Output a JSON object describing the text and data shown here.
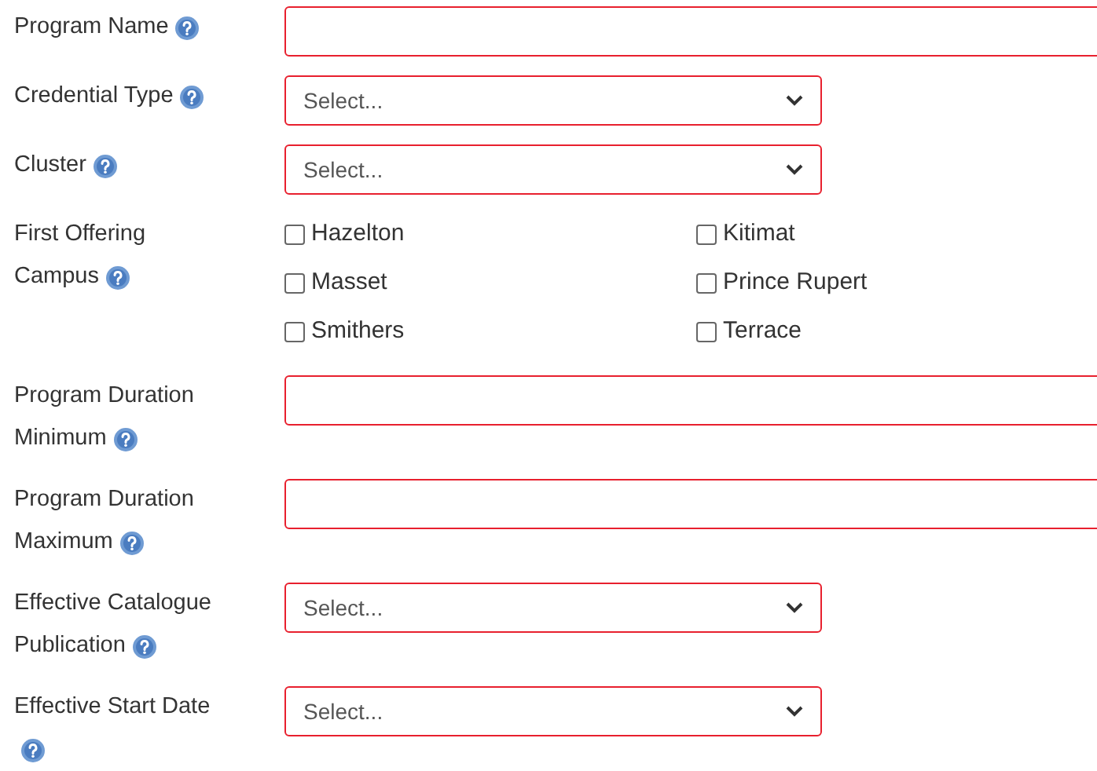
{
  "fields": [
    {
      "kind": "text",
      "label_lines": [
        "Program Name"
      ]
    },
    {
      "kind": "select",
      "label_lines": [
        "Credential Type"
      ],
      "placeholder": "Select..."
    },
    {
      "kind": "select",
      "label_lines": [
        "Cluster"
      ],
      "placeholder": "Select..."
    },
    {
      "kind": "checkboxes",
      "label_lines": [
        "First Offering",
        "Campus"
      ],
      "options": [
        {
          "label": "Hazelton",
          "checked": false
        },
        {
          "label": "Kitimat",
          "checked": false
        },
        {
          "label": "Masset",
          "checked": false
        },
        {
          "label": "Prince Rupert",
          "checked": false
        },
        {
          "label": "Smithers",
          "checked": false
        },
        {
          "label": "Terrace",
          "checked": false
        }
      ]
    },
    {
      "kind": "text",
      "label_lines": [
        "Program Duration",
        "Minimum"
      ]
    },
    {
      "kind": "text",
      "label_lines": [
        "Program Duration",
        "Maximum"
      ]
    },
    {
      "kind": "select",
      "label_lines": [
        "Effective Catalogue",
        "Publication"
      ],
      "placeholder": "Select..."
    },
    {
      "kind": "select",
      "label_lines": [
        "Effective Start Date"
      ],
      "placeholder": "Select..."
    }
  ]
}
